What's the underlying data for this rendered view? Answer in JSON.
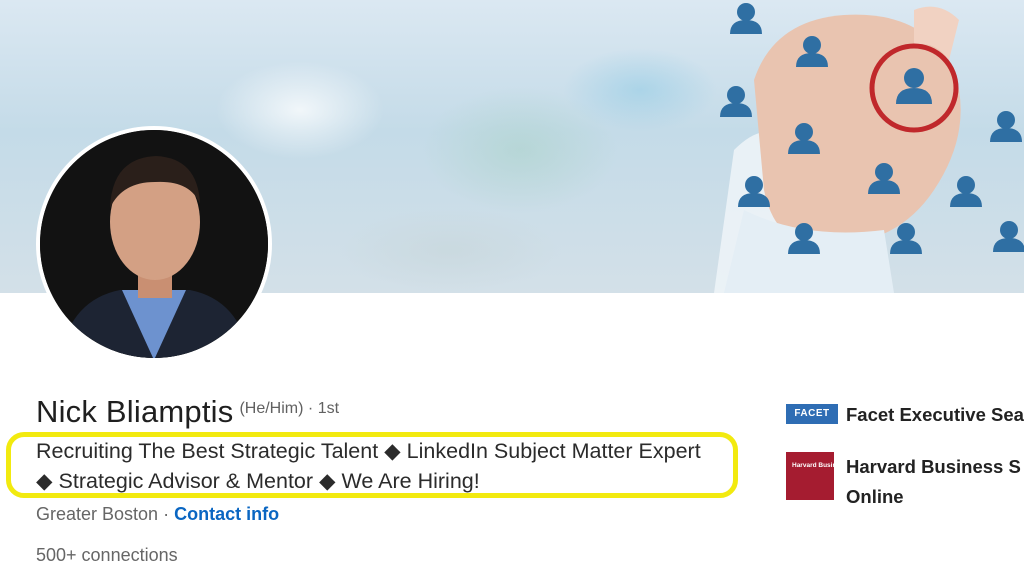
{
  "profile": {
    "name": "Nick Bliamptis",
    "pronouns": "(He/Him)",
    "separator": "·",
    "degree": "1st",
    "headline": "Recruiting The Best Strategic Talent ◆ LinkedIn Subject Matter Expert ◆ Strategic Advisor & Mentor ◆ We Are Hiring!",
    "location": "Greater Boston",
    "location_separator": "·",
    "contact_link": "Contact info",
    "connections": "500+ connections"
  },
  "experience": [
    {
      "logo_text": "FACET",
      "name": "Facet Executive Sea"
    },
    {
      "logo_text": "Harvard Business School Online",
      "name_line1": "Harvard Business S",
      "name_line2": "Online"
    }
  ],
  "colors": {
    "link": "#0a66c2",
    "highlight": "#f2ea0f",
    "text_primary": "#1f1f1f",
    "text_secondary": "#666666"
  },
  "icons": {
    "banner": "recruiting-network-people-icons",
    "avatar": "profile-photo"
  }
}
